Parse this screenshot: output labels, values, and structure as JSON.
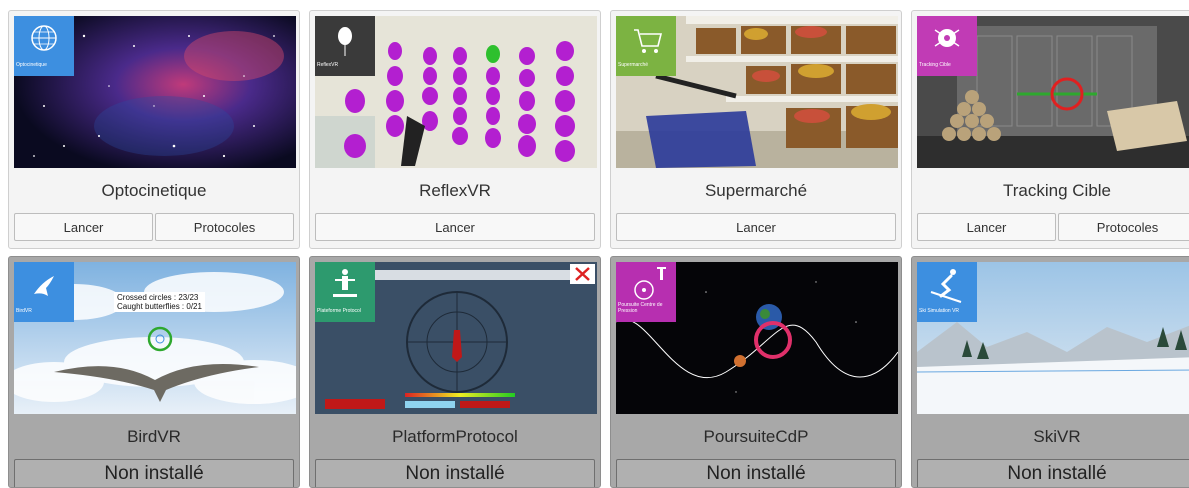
{
  "cards": [
    {
      "title": "Optocinetique",
      "badge_label": "Optocinetique",
      "badge_color": "#3d8fe0",
      "icon": "sphere-icon",
      "buttons": [
        "Lancer",
        "Protocoles"
      ],
      "installed": true
    },
    {
      "title": "ReflexVR",
      "badge_label": "ReflexVR",
      "badge_color": "#3a3a3a",
      "icon": "balloon-icon",
      "buttons": [
        "Lancer"
      ],
      "installed": true
    },
    {
      "title": "Supermarché",
      "badge_label": "Supermarché",
      "badge_color": "#7cb342",
      "icon": "cart-icon",
      "buttons": [
        "Lancer"
      ],
      "installed": true
    },
    {
      "title": "Tracking Cible",
      "badge_label": "Tracking Cible",
      "badge_color": "#c13bb5",
      "icon": "bug-target-icon",
      "buttons": [
        "Lancer",
        "Protocoles"
      ],
      "installed": true
    },
    {
      "title": "BirdVR",
      "badge_label": "BirdVR",
      "badge_color": "#3d8fe0",
      "icon": "bird-icon",
      "overlay_lines": [
        "Crossed circles : 23/23",
        "Caught butterflies : 0/21"
      ],
      "buttons": [
        "Non installé"
      ],
      "installed": false
    },
    {
      "title": "PlatformProtocol",
      "badge_label": "Plateforme Protocol",
      "badge_color": "#2d9a6e",
      "icon": "person-platform-icon",
      "buttons": [
        "Non installé"
      ],
      "installed": false
    },
    {
      "title": "PoursuiteCdP",
      "badge_label": "Poursuite Centre de Pression",
      "badge_color": "#b72fb0",
      "icon": "target-dot-icon",
      "buttons": [
        "Non installé"
      ],
      "installed": false
    },
    {
      "title": "SkiVR",
      "badge_label": "Ski Simulation VR",
      "badge_color": "#3d8fe0",
      "icon": "skier-icon",
      "buttons": [
        "Non installé"
      ],
      "installed": false
    }
  ]
}
